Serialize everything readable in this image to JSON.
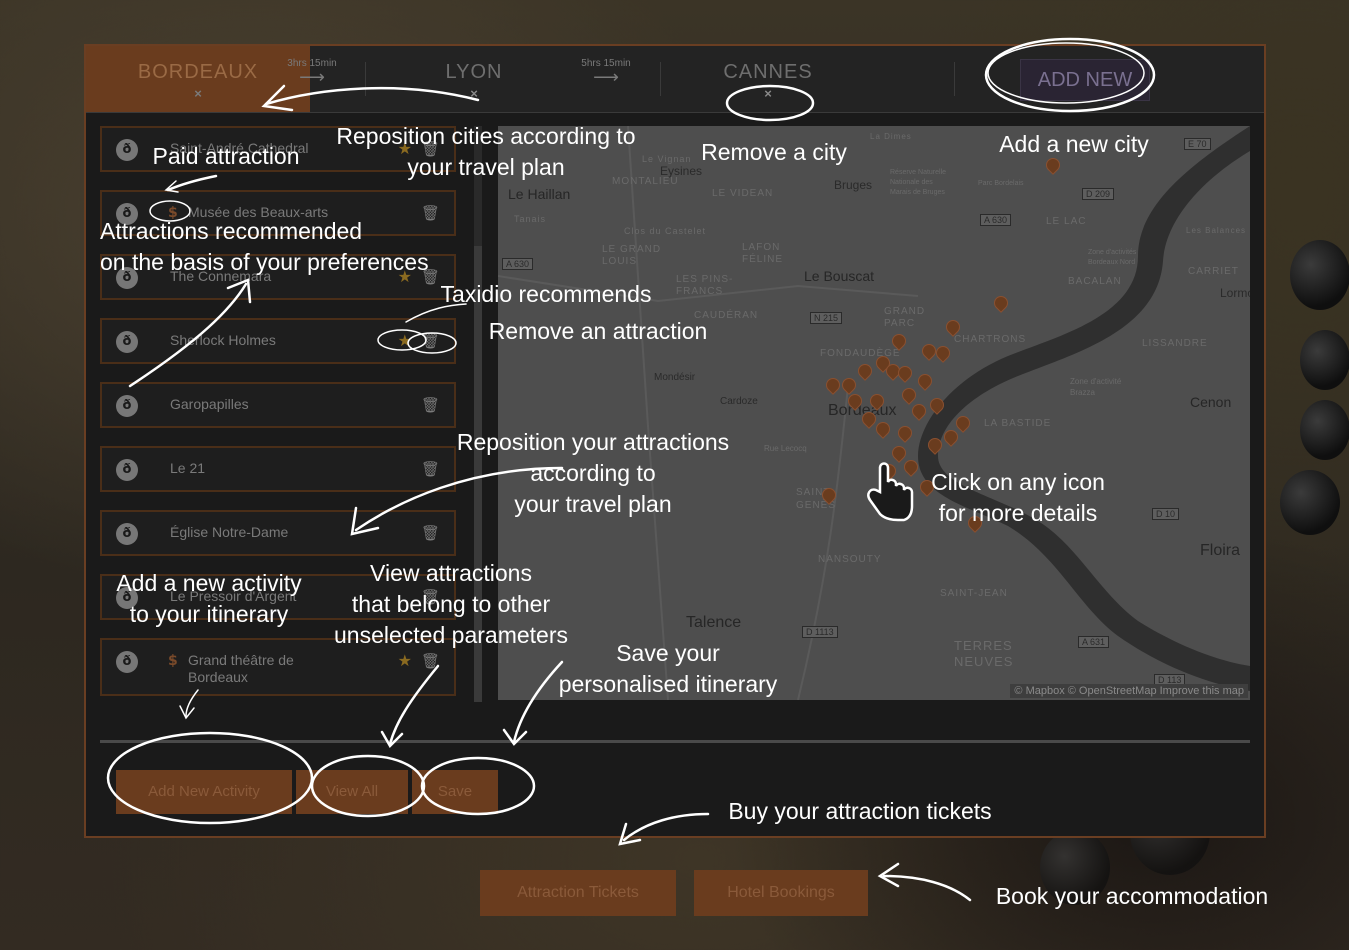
{
  "cities": [
    {
      "name": "BORDEAUX",
      "remove": "×",
      "active": true
    },
    {
      "name": "LYON",
      "remove": "×",
      "active": false
    },
    {
      "name": "CANNES",
      "remove": "×",
      "active": false
    }
  ],
  "travel_times": [
    {
      "label": "3hrs 15min",
      "arrow": "⟶"
    },
    {
      "label": "5hrs 15min",
      "arrow": "⟶"
    }
  ],
  "add_new_label": "ADD NEW",
  "attractions": [
    {
      "name": "Saint-André Cathedral",
      "paid": false,
      "recommended": true
    },
    {
      "name": "Musée des Beaux-arts",
      "paid": true,
      "recommended": false
    },
    {
      "name": "The Connemara",
      "paid": false,
      "recommended": true
    },
    {
      "name": "Sherlock Holmes",
      "paid": false,
      "recommended": true
    },
    {
      "name": "Garopapilles",
      "paid": false,
      "recommended": false
    },
    {
      "name": "Le 21",
      "paid": false,
      "recommended": false
    },
    {
      "name": "Église Notre-Dame",
      "paid": false,
      "recommended": false
    },
    {
      "name": "Le Pressoir d'Argent",
      "paid": false,
      "recommended": false
    },
    {
      "name": "Grand théâtre de Bordeaux",
      "paid": true,
      "recommended": true
    }
  ],
  "pin_glyph": "ð",
  "dollar_glyph": "$",
  "star_glyph": "★",
  "trash_glyph": "🗑",
  "map": {
    "labels": {
      "le_haillan": "Le Haillan",
      "eysines": "Eysines",
      "le_vignan": "Le Vignan",
      "montalieu": "MONTALIEU",
      "taillan": "Tanais",
      "clos_castelet": "Clos du Castelet",
      "le_videan": "LE VIDEAN",
      "le_grand_louis": "LE GRAND\nLOUIS",
      "lafon_feline": "LAFON\nFÉLINE",
      "les_pins_francs": "LES PINS-\nFRANCS",
      "le_bouscat": "Le Bouscat",
      "bruges": "Bruges",
      "le_lac": "LE LAC",
      "bacalan": "BACALAN",
      "lormont": "Lormon",
      "caudéran": "CAUDÉRAN",
      "grand_parc": "GRAND\nPARC",
      "chartrons": "CHARTRONS",
      "lissandre": "LISSANDRE",
      "fondaudege": "FONDAUDÈGE",
      "mondesir": "Mondésir",
      "cardoze": "Cardoze",
      "bordeaux": "Bordeaux",
      "la_bastide": "LA BASTIDE",
      "cenon": "Cenon",
      "saint_genes": "SAINT-\nGENÈS",
      "nansouty": "NANSOUTY",
      "floirac": "Floira",
      "saint_jean": "SAINT-JEAN",
      "talence": "Talence",
      "terres_neuves": "TERRES\nNEUVES",
      "le_carriet": "CARRIET",
      "la_dimes": "La Dimes",
      "les_balances": "Les Balances",
      "zone_activite": "Zone d'activité\nBrazza",
      "zone_nord": "Zone d'activités\nBordeaux Nord",
      "reserve": "Réserve Naturelle\nNationale des\nMarais de Bruges",
      "rue_lecocq": "Rue Lecocq",
      "parc_bordelais": "Parc Bordelais"
    },
    "badges": {
      "n215": "N 215",
      "a630": "A 630",
      "d209": "D 209",
      "d10": "D 10",
      "d1113": "D 1113",
      "a631": "A 631",
      "d113": "D 113",
      "a630b": "A 630",
      "e70": "E 70"
    },
    "attribution": "© Mapbox © OpenStreetMap  Improve this map"
  },
  "buttons": {
    "add_new_activity": "Add New Activity",
    "view_all": "View All",
    "save": "Save",
    "attraction_tickets": "Attraction Tickets",
    "hotel_bookings": "Hotel Bookings"
  },
  "annotations": {
    "reposition_cities": "Reposition cities according to\nyour travel plan",
    "remove_city": "Remove a city",
    "add_city": "Add a new city",
    "paid_attraction": "Paid attraction",
    "recommended": "Attractions recommended\non the basis of your preferences",
    "taxidio": "Taxidio recommends",
    "remove_attraction": "Remove an attraction",
    "reposition_attractions": "Reposition your attractions\naccording to\nyour travel plan",
    "click_icon": "Click on any icon\nfor more details",
    "add_activity": "Add a new activity\nto your itinerary",
    "view_attractions": "View attractions\nthat belong to other\nunselected parameters",
    "save_itinerary": "Save your\npersonalised itinerary",
    "buy_tickets": "Buy your attraction tickets",
    "book_accommodation": "Book your accommodation"
  },
  "colors": {
    "accent": "#6a3c1e",
    "annotation": "#ffffff",
    "panel": "#1a1a1a",
    "map": "#4e4e4e"
  }
}
